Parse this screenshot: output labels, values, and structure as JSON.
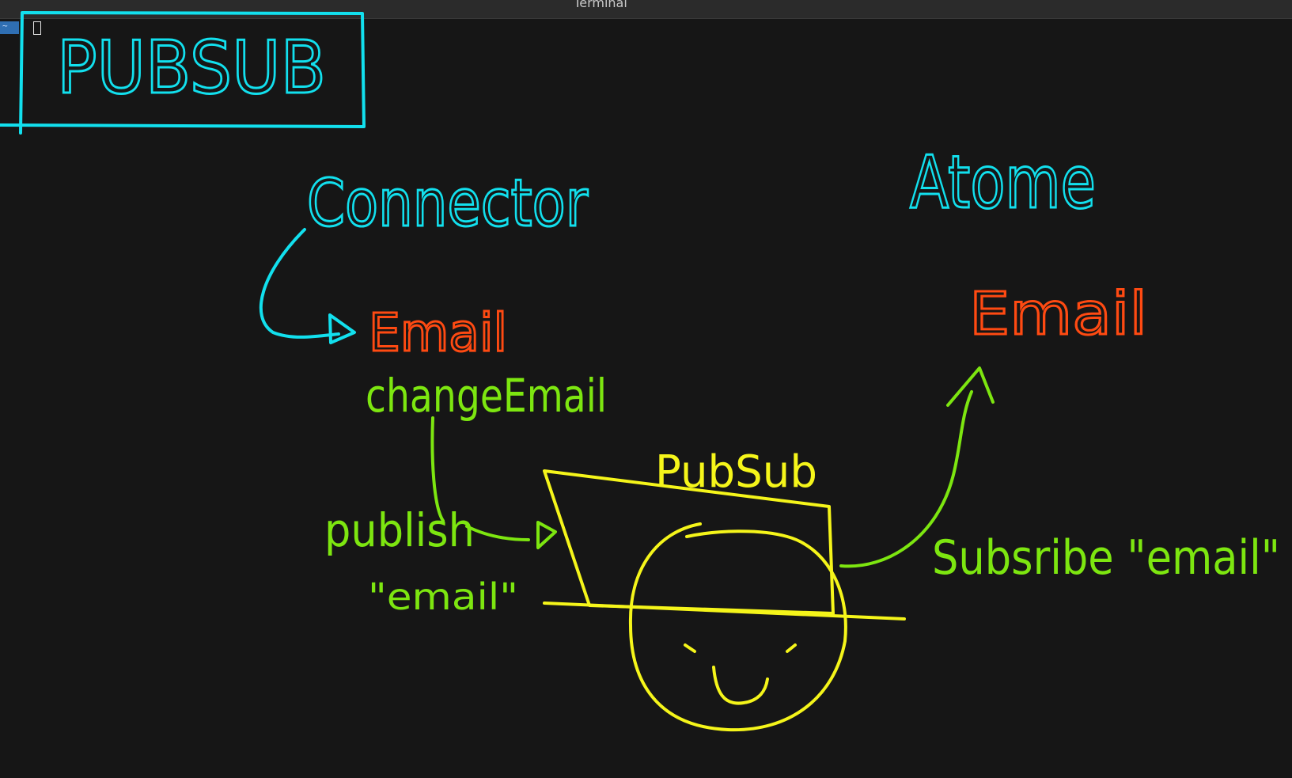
{
  "window": {
    "title": "Terminal",
    "prompt_symbol": "~"
  },
  "drawing": {
    "title_box_label": "PUBSUB",
    "connector_label": "Connector",
    "atom_label": "Atome",
    "email_left": "Email",
    "email_right": "Email",
    "change_email_label": "changeEmail",
    "pubsub_label": "PubSub",
    "publish_label": "publish",
    "publish_arg": "\"email\"",
    "subscribe_label": "Subsribe \"email\""
  },
  "colors": {
    "background": "#161616",
    "cyan": "#12e0ee",
    "orange": "#ff4a12",
    "green": "#7de610",
    "yellow": "#f5f51a"
  }
}
